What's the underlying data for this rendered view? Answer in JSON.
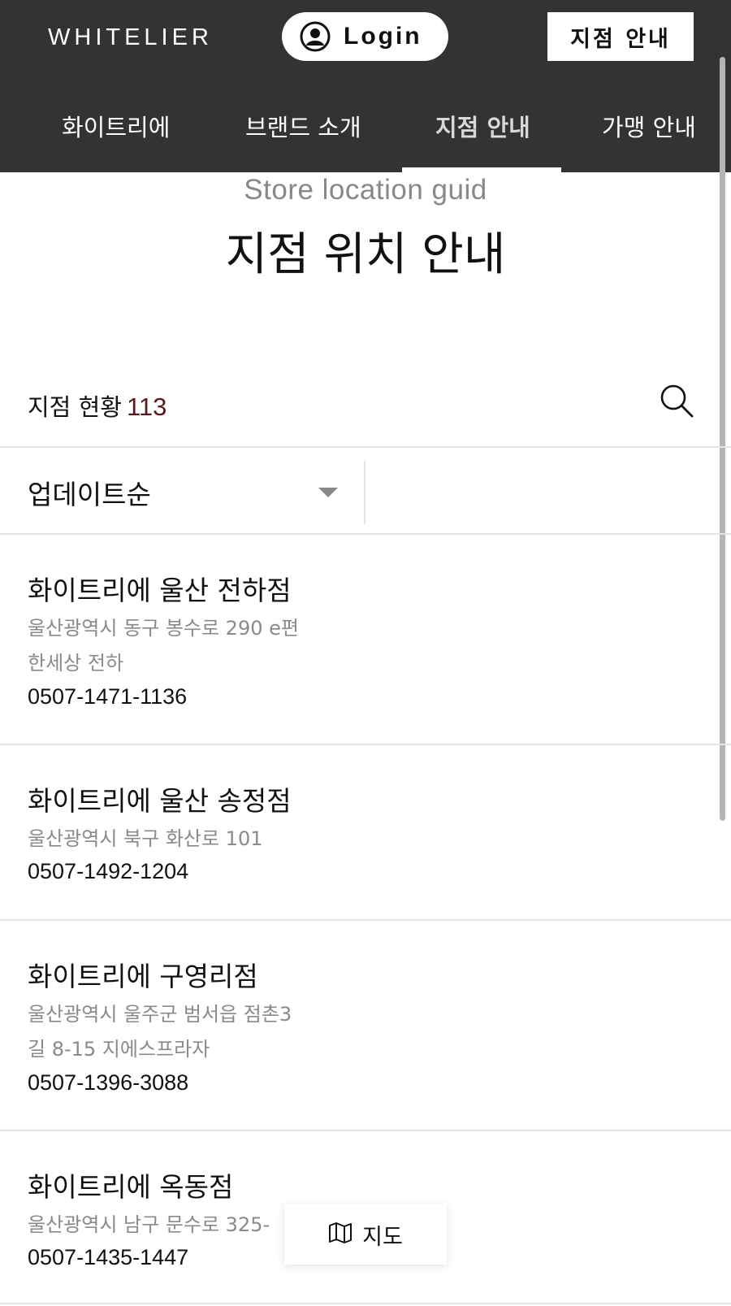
{
  "header": {
    "logo": "WHITELIER",
    "login_label": "Login",
    "store_button_label": "지점 안내",
    "nav": [
      {
        "label": "화이트리에",
        "active": false
      },
      {
        "label": "브랜드 소개",
        "active": false
      },
      {
        "label": "지점 안내",
        "active": true
      },
      {
        "label": "가맹 안내",
        "active": false
      }
    ]
  },
  "page": {
    "subtitle": "Store location guid",
    "title": "지점 위치 안내"
  },
  "stats": {
    "label": "지점 현황",
    "count": "113"
  },
  "sort": {
    "selected": "업데이트순"
  },
  "stores": [
    {
      "name": "화이트리에 울산 전하점",
      "address_line1": "울산광역시 동구 봉수로 290 e편",
      "address_line2": "한세상 전하",
      "phone": "0507-1471-1136"
    },
    {
      "name": "화이트리에 울산 송정점",
      "address_line1": "울산광역시 북구 화산로 101",
      "phone": "0507-1492-1204"
    },
    {
      "name": "화이트리에 구영리점",
      "address_line1": "울산광역시 울주군 범서읍 점촌3",
      "address_line2": "길 8-15 지에스프라자",
      "phone": "0507-1396-3088"
    },
    {
      "name": "화이트리에 옥동점",
      "address_line1": "울산광역시 남구 문수로 325-",
      "phone": "0507-1435-1447"
    }
  ],
  "map_button": {
    "label": "지도"
  },
  "colors": {
    "header_bg": "#333333",
    "count_accent": "#5a1a1a"
  }
}
